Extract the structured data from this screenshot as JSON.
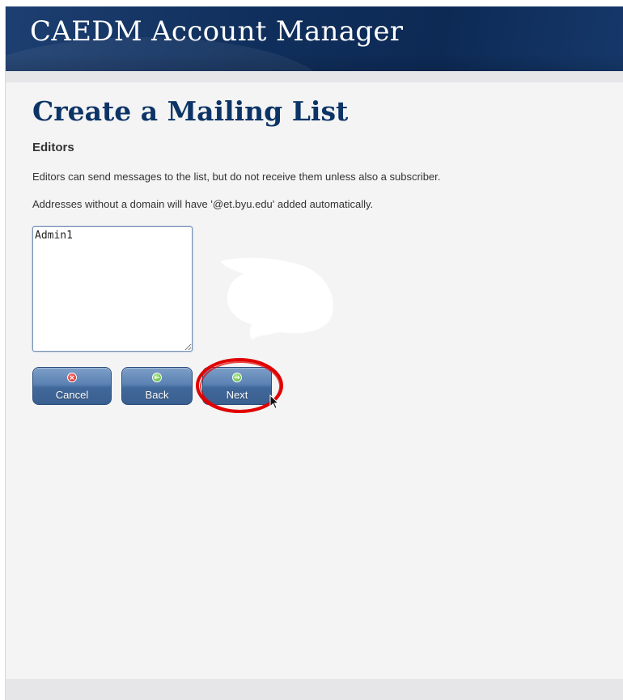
{
  "header": {
    "app_title": "CAEDM Account Manager"
  },
  "page": {
    "title": "Create a Mailing List",
    "section_heading": "Editors",
    "description_1": "Editors can send messages to the list, but do not receive them unless also a subscriber.",
    "description_2": "Addresses without a domain will have '@et.byu.edu' added automatically."
  },
  "editors_field": {
    "value": "Admin1"
  },
  "buttons": {
    "cancel": {
      "label": "Cancel",
      "icon": "cancel-icon"
    },
    "back": {
      "label": "Back",
      "icon": "back-arrow-icon"
    },
    "next": {
      "label": "Next",
      "icon": "next-arrow-icon"
    }
  },
  "colors": {
    "header_bg": "#102f5c",
    "title_color": "#0c3466",
    "button_blue": "#4a72a6",
    "highlight_red": "#e00000"
  }
}
